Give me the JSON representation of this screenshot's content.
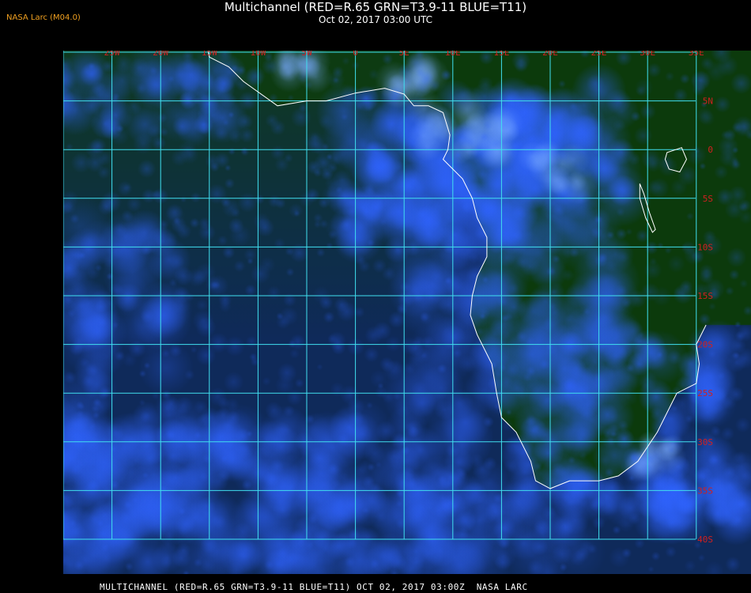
{
  "header": {
    "title": "Multichannel (RED=R.65 GRN=T3.9-11 BLUE=T11)",
    "datetime": "Oct 02, 2017 03:00 UTC",
    "credit": "NASA Larc (M04.0)"
  },
  "footer": {
    "caption": "MULTICHANNEL (RED=R.65 GRN=T3.9-11 BLUE=T11) OCT 02, 2017 03:00Z  NASA LARC"
  },
  "map": {
    "longitude_labels": [
      "25W",
      "20W",
      "15W",
      "10W",
      "5W",
      "0",
      "5E",
      "10E",
      "15E",
      "20E",
      "25E",
      "30E",
      "35E"
    ],
    "latitude_labels": [
      "5N",
      "0",
      "5S",
      "10S",
      "15S",
      "20S",
      "25S",
      "30S",
      "35S",
      "40S"
    ],
    "lon_range": [
      -30,
      35
    ],
    "lat_range": [
      -40,
      10
    ],
    "colors": {
      "grid": "#40e0f0",
      "grid_label": "#d02020",
      "coastline": "#ffffff",
      "land": "#0c3a0c",
      "ocean": "#0f2a5a",
      "cloud": "#2f63ff"
    },
    "coastline_lonlat": [
      [
        -15.5,
        12
      ],
      [
        -15,
        9.5
      ],
      [
        -13,
        8.5
      ],
      [
        -11.5,
        7
      ],
      [
        -8,
        4.5
      ],
      [
        -5,
        5
      ],
      [
        -3,
        5
      ],
      [
        0,
        5.8
      ],
      [
        3,
        6.3
      ],
      [
        5,
        5.7
      ],
      [
        6,
        4.5
      ],
      [
        7.5,
        4.5
      ],
      [
        9,
        3.8
      ],
      [
        9.7,
        1.5
      ],
      [
        9.5,
        0
      ],
      [
        9,
        -1
      ],
      [
        11,
        -3
      ],
      [
        12,
        -5
      ],
      [
        12.5,
        -7
      ],
      [
        13.5,
        -9
      ],
      [
        13.5,
        -11
      ],
      [
        12.5,
        -13
      ],
      [
        12,
        -15
      ],
      [
        11.8,
        -17
      ],
      [
        12.5,
        -19
      ],
      [
        14,
        -22
      ],
      [
        14.5,
        -25
      ],
      [
        15,
        -27.5
      ],
      [
        16.5,
        -29
      ],
      [
        18,
        -32
      ],
      [
        18.5,
        -34
      ],
      [
        20,
        -34.8
      ],
      [
        22,
        -34
      ],
      [
        25,
        -34
      ],
      [
        27,
        -33.5
      ],
      [
        29,
        -32
      ],
      [
        31,
        -29
      ],
      [
        32.5,
        -26
      ],
      [
        33,
        -25
      ],
      [
        35,
        -24
      ],
      [
        35.3,
        -22
      ],
      [
        35,
        -20
      ],
      [
        36,
        -18
      ]
    ]
  }
}
